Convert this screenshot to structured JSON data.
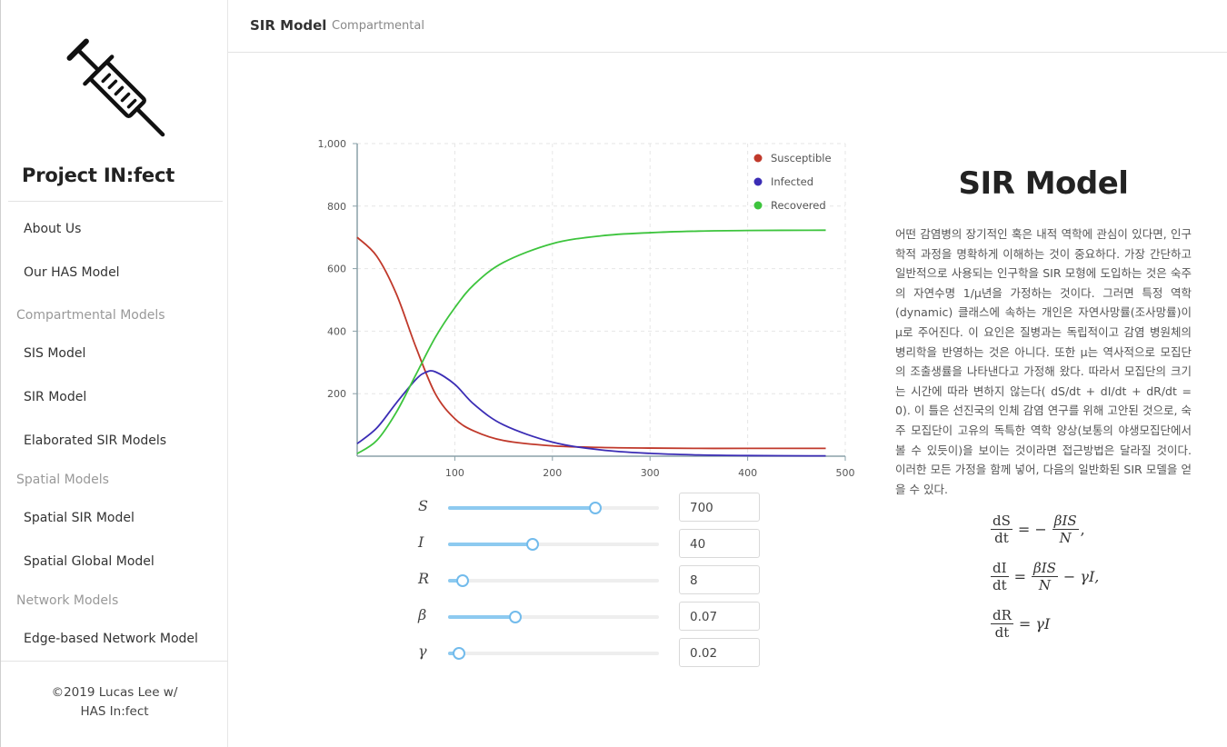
{
  "sidebar": {
    "brand": "Project IN:fect",
    "items": [
      {
        "label": "About Us",
        "type": "link"
      },
      {
        "label": "Our HAS Model",
        "type": "link"
      },
      {
        "label": "Compartmental Models",
        "type": "group"
      },
      {
        "label": "SIS Model",
        "type": "link"
      },
      {
        "label": "SIR Model",
        "type": "link"
      },
      {
        "label": "Elaborated SIR Models",
        "type": "link"
      },
      {
        "label": "Spatial Models",
        "type": "group"
      },
      {
        "label": "Spatial SIR Model",
        "type": "link"
      },
      {
        "label": "Spatial Global Model",
        "type": "link"
      },
      {
        "label": "Network Models",
        "type": "group"
      },
      {
        "label": "Edge-based Network Model",
        "type": "link"
      }
    ],
    "footer_line1": "©2019 Lucas Lee w/",
    "footer_line2": "HAS In:fect",
    "logo_icon": "syringe-icon"
  },
  "header": {
    "title": "SIR Model",
    "subtitle": "Compartmental"
  },
  "chart_data": {
    "type": "line",
    "x_ticks": [
      100,
      200,
      300,
      400,
      500
    ],
    "y_ticks": [
      "200",
      "400",
      "600",
      "800",
      "1,000"
    ],
    "xlim": [
      0,
      500
    ],
    "ylim": [
      0,
      1000
    ],
    "grid": true,
    "legend_position": "top-right",
    "series": [
      {
        "name": "Susceptible",
        "color": "#c0392b",
        "x": [
          0,
          20,
          40,
          60,
          80,
          100,
          120,
          150,
          200,
          250,
          300,
          350,
          400,
          480
        ],
        "y": [
          700,
          640,
          520,
          350,
          200,
          120,
          80,
          50,
          33,
          28,
          26,
          25,
          25,
          25
        ]
      },
      {
        "name": "Infected",
        "color": "#3b2db5",
        "x": [
          0,
          20,
          40,
          60,
          70,
          80,
          100,
          120,
          150,
          200,
          250,
          300,
          350,
          400,
          480
        ],
        "y": [
          40,
          90,
          170,
          245,
          268,
          270,
          230,
          165,
          100,
          45,
          20,
          9,
          4,
          2,
          1
        ]
      },
      {
        "name": "Recovered",
        "color": "#3dc43d",
        "x": [
          0,
          20,
          40,
          60,
          80,
          100,
          120,
          150,
          200,
          250,
          300,
          350,
          400,
          480
        ],
        "y": [
          8,
          50,
          140,
          260,
          380,
          475,
          550,
          620,
          680,
          705,
          715,
          720,
          722,
          723
        ]
      }
    ]
  },
  "controls": [
    {
      "symbol": "S",
      "value": "700",
      "fraction": 0.7
    },
    {
      "symbol": "I",
      "value": "40",
      "fraction": 0.4
    },
    {
      "symbol": "R",
      "value": "8",
      "fraction": 0.07
    },
    {
      "symbol": "β",
      "value": "0.07",
      "fraction": 0.32
    },
    {
      "symbol": "γ",
      "value": "0.02",
      "fraction": 0.05
    }
  ],
  "description": {
    "title": "SIR Model",
    "body": "어떤 감염병의 장기적인 혹은 내적 역학에 관심이 있다면, 인구학적 과정을 명확하게 이해하는 것이 중요하다. 가장 간단하고 일반적으로 사용되는 인구학을 SIR 모형에 도입하는 것은 숙주의 자연수명 1/μ년을 가정하는 것이다. 그러면 특정 역학(dynamic) 클래스에 속하는 개인은 자연사망률(조사망률)이 μ로 주어진다. 이 요인은 질병과는 독립적이고 감염 병원체의 병리학을 반영하는 것은 아니다. 또한 μ는 역사적으로 모집단의 조출생률을 나타낸다고 가정해 왔다. 따라서 모집단의 크기는 시간에 따라 변하지 않는다( dS/dt + dI/dt + dR/dt = 0). 이 틀은 선진국의 인체 감염 연구를 위해 고안된 것으로, 숙주 모집단이 고유의 독특한 역학 양상(보통의 야생모집단에서 볼 수 있듯이)을 보이는 것이라면 접근방법은 달라질 것이다. 이러한 모든 가정을 함께 넣어, 다음의 일반화된 SIR 모델을 얻을 수 있다."
  },
  "equations": {
    "eq1_num": "dS",
    "eq1_den": "dt",
    "eq1_rhs_pre": "= −",
    "eq1_rhs_num": "βIS",
    "eq1_rhs_den": "N",
    "eq1_rhs_post": ",",
    "eq2_num": "dI",
    "eq2_den": "dt",
    "eq2_rhs_pre": "=",
    "eq2_rhs_num": "βIS",
    "eq2_rhs_den": "N",
    "eq2_rhs_post": "− γI,",
    "eq3_num": "dR",
    "eq3_den": "dt",
    "eq3_rhs": "= γI"
  }
}
